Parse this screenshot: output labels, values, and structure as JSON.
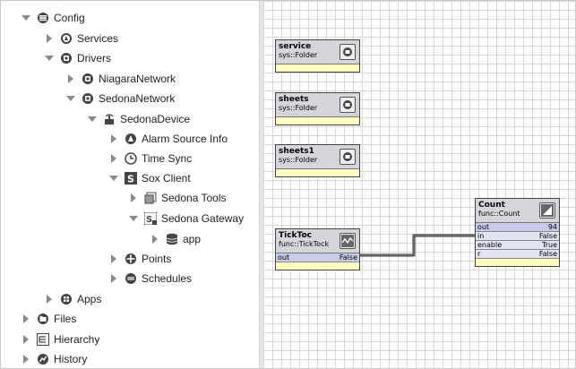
{
  "tree": {
    "config": "Config",
    "services": "Services",
    "drivers": "Drivers",
    "niagara_network": "NiagaraNetwork",
    "sedona_network": "SedonaNetwork",
    "sedona_device": "SedonaDevice",
    "alarm_source_info": "Alarm Source Info",
    "time_sync": "Time Sync",
    "sox_client": "Sox Client",
    "sedona_tools": "Sedona Tools",
    "sedona_gateway": "Sedona Gateway",
    "app": "app",
    "points": "Points",
    "schedules": "Schedules",
    "apps": "Apps",
    "files": "Files",
    "hierarchy": "Hierarchy",
    "history": "History"
  },
  "canvas": {
    "service": {
      "name": "service",
      "type": "sys::Folder"
    },
    "sheets": {
      "name": "sheets",
      "type": "sys::Folder"
    },
    "sheets1": {
      "name": "sheets1",
      "type": "sys::Folder"
    },
    "ticktoc": {
      "name": "TickToc",
      "type": "func::TickTock",
      "slots": [
        {
          "name": "out",
          "value": "False"
        }
      ]
    },
    "count": {
      "name": "Count",
      "type": "func::Count",
      "slots": [
        {
          "name": "out",
          "value": "94"
        },
        {
          "name": "in",
          "value": "False"
        },
        {
          "name": "enable",
          "value": "True"
        },
        {
          "name": "r",
          "value": "False"
        }
      ]
    }
  }
}
